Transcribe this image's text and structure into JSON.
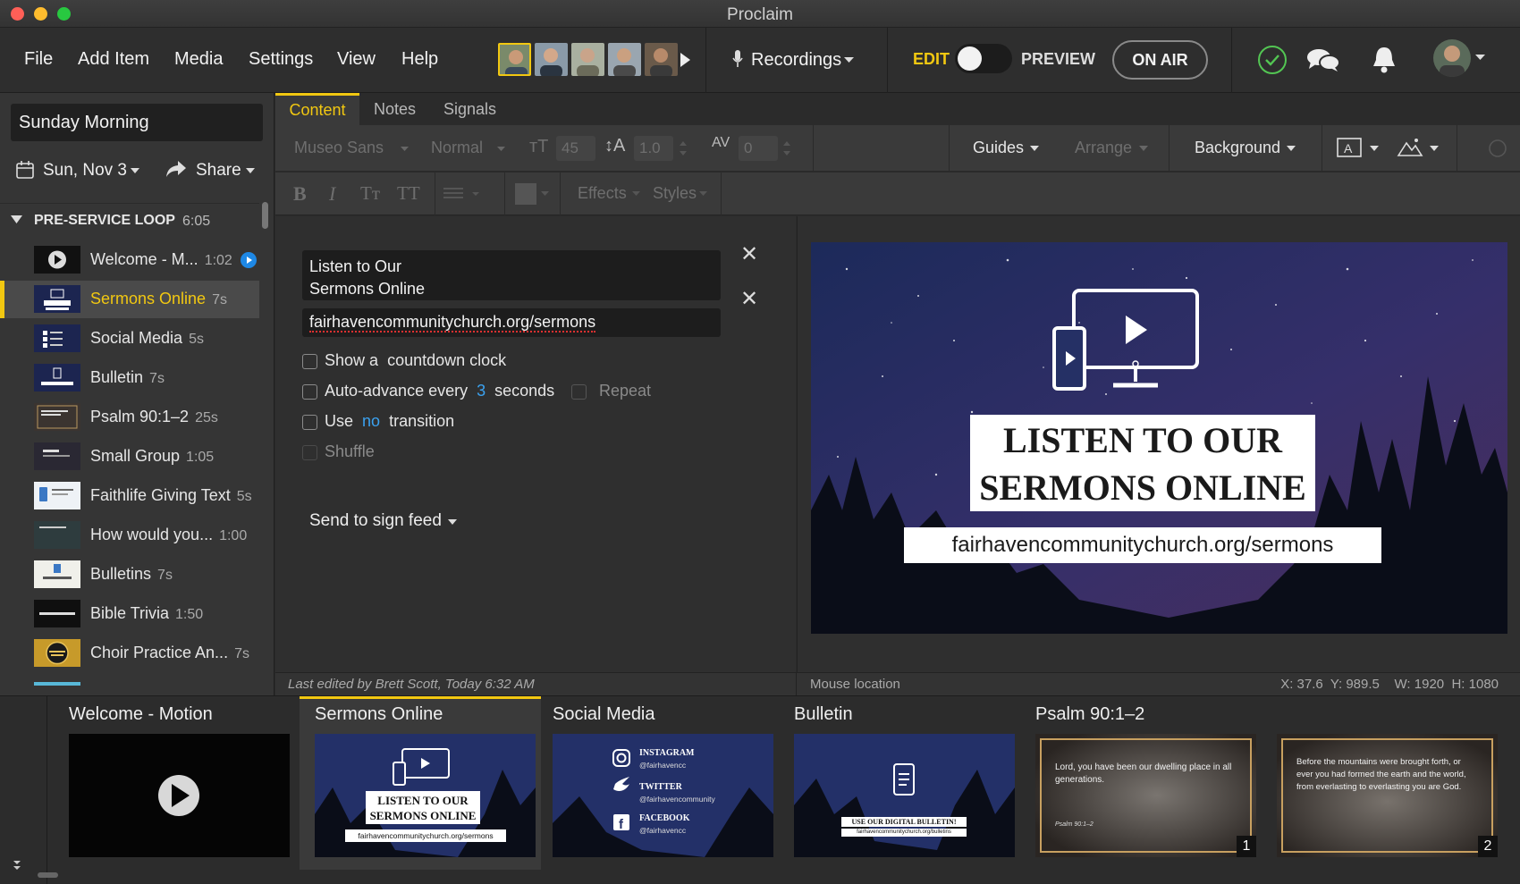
{
  "app": {
    "title": "Proclaim"
  },
  "menu": [
    "File",
    "Add Item",
    "Media",
    "Settings",
    "View",
    "Help"
  ],
  "recordings_label": "Recordings",
  "mode": {
    "edit": "EDIT",
    "preview": "PREVIEW",
    "on_air": "ON AIR"
  },
  "sidebar": {
    "service_name": "Sunday Morning",
    "date": "Sun, Nov 3",
    "share": "Share",
    "section": {
      "name": "PRE-SERVICE LOOP",
      "duration": "6:05"
    },
    "items": [
      {
        "label": "Welcome - M...",
        "duration": "1:02"
      },
      {
        "label": "Sermons Online",
        "duration": "7s"
      },
      {
        "label": "Social Media",
        "duration": "5s"
      },
      {
        "label": "Bulletin",
        "duration": "7s"
      },
      {
        "label": "Psalm 90:1–2",
        "duration": "25s"
      },
      {
        "label": "Small Group",
        "duration": "1:05"
      },
      {
        "label": "Faithlife Giving Text",
        "duration": "5s"
      },
      {
        "label": "How would you...",
        "duration": "1:00"
      },
      {
        "label": "Bulletins",
        "duration": "7s"
      },
      {
        "label": "Bible Trivia",
        "duration": "1:50"
      },
      {
        "label": "Choir Practice An...",
        "duration": "7s"
      }
    ]
  },
  "tabs": [
    "Content",
    "Notes",
    "Signals"
  ],
  "toolbar": {
    "font": "Museo Sans",
    "weight": "Normal",
    "size": "45",
    "line_height": "1.0",
    "spacing": "0",
    "guides": "Guides",
    "arrange": "Arrange",
    "background": "Background",
    "effects": "Effects",
    "styles": "Styles",
    "bold": "B",
    "italic": "I",
    "small_caps": "Tт",
    "caps": "TT"
  },
  "editor": {
    "field1": [
      "Listen to Our",
      "Sermons Online"
    ],
    "field2": "fairhavencommunitychurch.org/sermons",
    "countdown": {
      "pre": "Show a",
      "post": "countdown clock"
    },
    "auto_advance": {
      "pre": "Auto-advance every",
      "value": "3",
      "post": "seconds"
    },
    "repeat": "Repeat",
    "transition": {
      "pre": "Use",
      "value": "no",
      "post": "transition"
    },
    "shuffle": "Shuffle",
    "send": "Send to sign feed"
  },
  "slide": {
    "title1": "LISTEN TO OUR",
    "title2": "SERMONS ONLINE",
    "url": "fairhavencommunitychurch.org/sermons"
  },
  "status": {
    "last_edited": "Last edited by Brett Scott, Today 6:32 AM",
    "mouse": "Mouse location",
    "coords": "X: 37.6  Y: 989.5    W: 1920  H: 1080"
  },
  "thumbnails": [
    {
      "title": "Welcome - Motion"
    },
    {
      "title": "Sermons Online",
      "l1": "LISTEN TO OUR",
      "l2": "SERMONS ONLINE",
      "url": "fairhavencommunitychurch.org/sermons"
    },
    {
      "title": "Social Media",
      "r1": "INSTAGRAM",
      "h1": "@fairhavencc",
      "r2": "TWITTER",
      "h2": "@fairhavencommunity",
      "r3": "FACEBOOK",
      "h3": "@fairhavencc"
    },
    {
      "title": "Bulletin",
      "l1": "USE OUR DIGITAL BULLETIN!",
      "url": "fairhavencommunitychurch.org/bulletins"
    },
    {
      "title": "Psalm 90:1–2",
      "text": "Lord, you have been our dwelling place in all generations.",
      "ref": "Psalm 90:1–2",
      "num": "1"
    },
    {
      "title": "",
      "text": "Before the mountains were brought forth, or ever you had formed the earth and the world, from everlasting to everlasting you are God.",
      "num": "2"
    }
  ],
  "colors": {
    "accent": "#f2c811",
    "link": "#3ba2f0",
    "check": "#53c653"
  }
}
